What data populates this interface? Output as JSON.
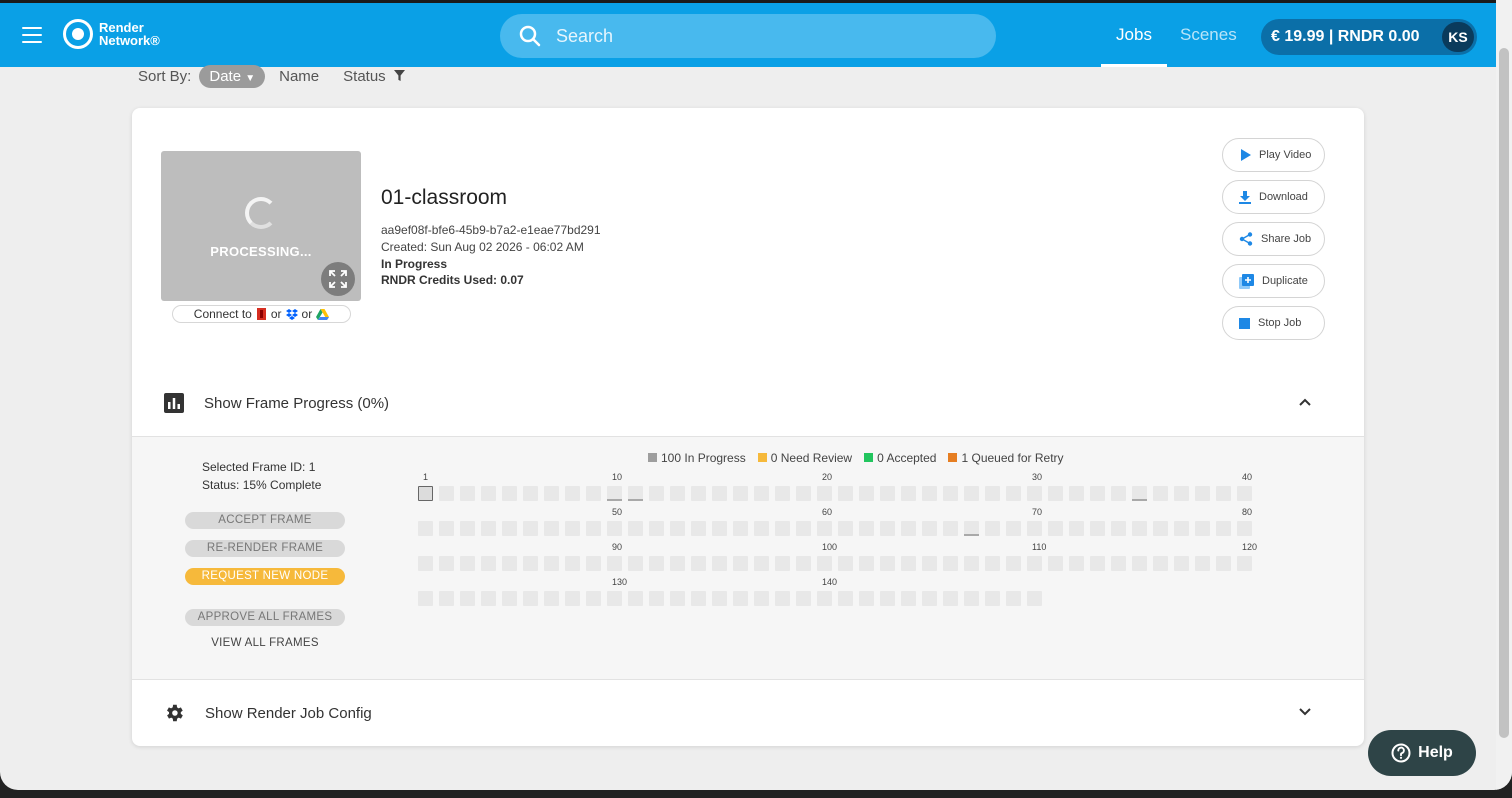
{
  "header": {
    "logo_line1": "Render",
    "logo_line2": "Network®",
    "search_placeholder": "Search",
    "nav_jobs": "Jobs",
    "nav_scenes": "Scenes",
    "wallet_text": "€ 19.99 | RNDR 0.00",
    "avatar_initials": "KS",
    "accent_color": "#0aa0e6"
  },
  "sort": {
    "label": "Sort By:",
    "selected": "Date",
    "option_name": "Name",
    "option_status": "Status"
  },
  "job": {
    "title": "01-classroom",
    "id": "aa9ef08f-bfe6-45b9-b7a2-e1eae77bd291",
    "created": "Created: Sun Aug 02 2026 - 06:02 AM",
    "status": "In Progress",
    "credits": "RNDR Credits Used: 0.07",
    "processing_text": "PROCESSING...",
    "connect_prefix": "Connect to",
    "connect_or1": "or",
    "connect_or2": "or"
  },
  "actions": {
    "play_video": "Play Video",
    "download": "Download",
    "share_job": "Share Job",
    "duplicate": "Duplicate",
    "stop_job": "Stop Job"
  },
  "frame_progress": {
    "header_label": "Show Frame Progress (0%)",
    "selected_frame": "Selected Frame ID: 1",
    "selected_status": "Status: 15% Complete",
    "btn_accept": "ACCEPT FRAME",
    "btn_rerender": "RE-RENDER FRAME",
    "btn_request_node": "REQUEST NEW NODE",
    "btn_approve_all": "APPROVE ALL FRAMES",
    "btn_view_all": "VIEW ALL FRAMES",
    "legend": [
      {
        "text": "100 In Progress",
        "color": "#9e9e9e"
      },
      {
        "text": "0 Need Review",
        "color": "#f6b93b"
      },
      {
        "text": "0 Accepted",
        "color": "#22c55e"
      },
      {
        "text": "1 Queued for Retry",
        "color": "#e67e22"
      }
    ],
    "total_frames": 150,
    "frames_per_row": 40,
    "tick_labels": [
      1,
      10,
      20,
      30,
      40,
      50,
      60,
      70,
      80,
      90,
      100,
      110,
      120,
      130,
      140
    ],
    "selected_frame_id": 1,
    "partial_frames": [
      {
        "frame": 10,
        "progress": 0.15
      },
      {
        "frame": 11,
        "progress": 0.15
      },
      {
        "frame": 35,
        "progress": 0.15
      },
      {
        "frame": 67,
        "progress": 0.15
      }
    ]
  },
  "config": {
    "header_label": "Show Render Job Config"
  },
  "help": {
    "label": "Help"
  }
}
